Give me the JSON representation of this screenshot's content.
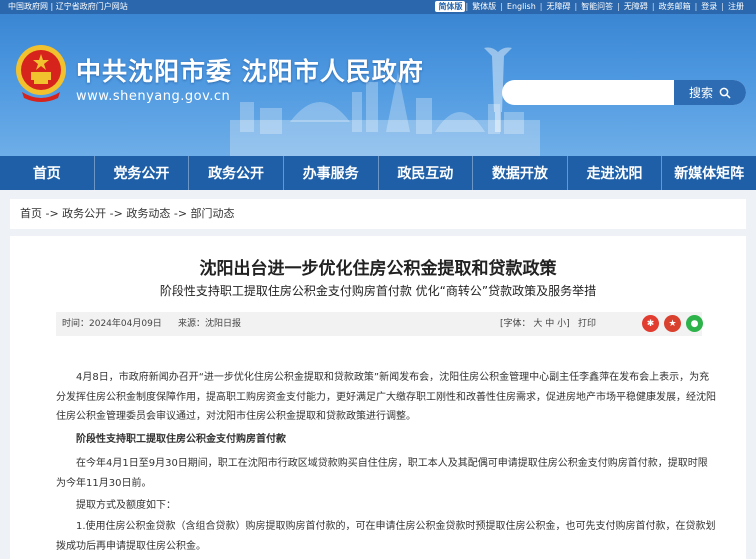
{
  "topbar": {
    "left_links": [
      "中国政府网",
      "辽宁省政府门户网站"
    ],
    "right_links": [
      "简体版",
      "繁体版",
      "English",
      "无障碍",
      "智能问答",
      "无障碍",
      "政务邮箱",
      "登录",
      "注册"
    ],
    "active_index": 0
  },
  "header": {
    "title": "中共沈阳市委  沈阳市人民政府",
    "url": "www.shenyang.gov.cn",
    "search_placeholder": "",
    "search_label": "搜索"
  },
  "nav": [
    "首页",
    "党务公开",
    "政务公开",
    "办事服务",
    "政民互动",
    "数据开放",
    "走进沈阳",
    "新媒体矩阵"
  ],
  "breadcrumb": "首页 -> 政务公开 -> 政务动态 -> 部门动态",
  "article": {
    "title": "沈阳出台进一步优化住房公积金提取和贷款政策",
    "subtitle": "阶段性支持职工提取住房公积金支付购房首付款 优化“商转公”贷款政策及服务举措",
    "date": "时间：2024年04月09日",
    "source": "来源：沈阳日报",
    "font_size": "[字体：  大  中  小]",
    "print": "打印",
    "paragraphs": [
      "4月8日，市政府新闻办召开“进一步优化住房公积金提取和贷款政策”新闻发布会，沈阳住房公积金管理中心副主任李鑫萍在发布会上表示，为充分发挥住房公积金制度保障作用，提高职工购房资金支付能力，更好满足广大缴存职工刚性和改善性住房需求，促进房地产市场平稳健康发展，经沈阳住房公积金管理委员会审议通过，对沈阳市住房公积金提取和贷款政策进行调整。",
      "阶段性支持职工提取住房公积金支付购房首付款",
      "在今年4月1日至9月30日期间，职工在沈阳市行政区域贷款购买自住住房，职工本人及其配偶可申请提取住房公积金支付购房首付款，提取时限为今年11月30日前。",
      "提取方式及额度如下：",
      "1.使用住房公积金贷款（含组合贷款）购房提取购房首付款的，可在申请住房公积金贷款时预提取住房公积金，也可先支付购房首付款，在贷款划拨成功后再申请提取住房公积金。"
    ]
  },
  "colors": {
    "nav": "#1e5fa8",
    "banner": "#4d98e0",
    "topbar": "#2a67ad"
  }
}
